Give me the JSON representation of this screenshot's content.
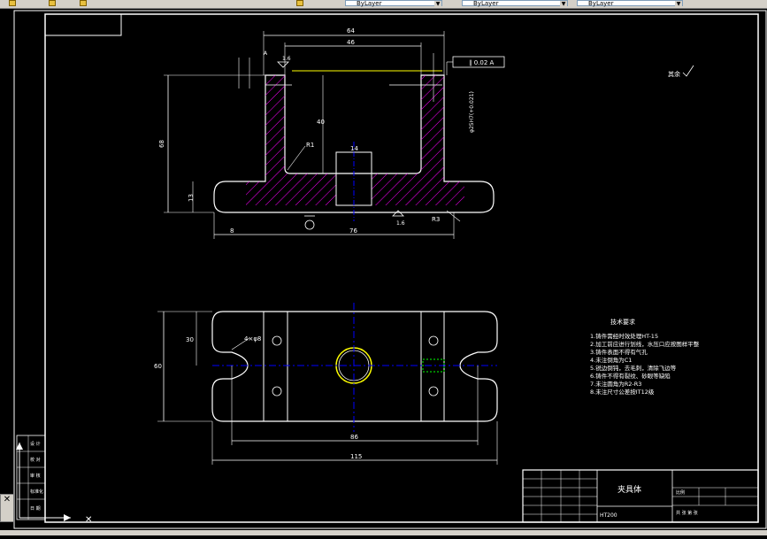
{
  "toolbar": {
    "combos": [
      "ByLayer",
      "ByLayer",
      "ByLayer"
    ],
    "colors": {
      "face": "#d4d0c8",
      "combo_bg": "#ffffff"
    }
  },
  "drawing": {
    "colors": {
      "background": "#000000",
      "lines": "#ffffff",
      "hatch": "#ff00ff",
      "centerline": "#0000ff",
      "yellow": "#ffff00",
      "green": "#00ff00"
    },
    "front_view": {
      "dim_top_outer": "64",
      "dim_top_inner": "46",
      "dim_left_height": "68",
      "dim_inner_height": "40",
      "dim_base_height": "13",
      "dim_bottom": "76",
      "dim_bottom_left": "8",
      "dim_slot": "14",
      "radius_label": "R1",
      "radius_label_2": "R3",
      "roughness_top": "1.6",
      "roughness_bottom": "1.6",
      "datum_flag": "∥ 0.02 A",
      "datum_letter": "A",
      "side_note": "φ25H7(+0.021)"
    },
    "top_view": {
      "dim_width": "60",
      "dim_inner": "30",
      "dim_span_inner": "86",
      "dim_span_outer": "115",
      "hole_label": "4×φ8"
    },
    "roughness_corner": "其余",
    "tech_req_title": "技术要求",
    "tech_reqs": [
      "1.铸件需经时效处理HT-15",
      "2.加工前应进行划线，水压口应按图样平整",
      "3.铸件表面不得有气孔",
      "4.未注倒角为C1",
      "5.锐边倒钝，去毛刺，清除飞边等",
      "6.铸件不得有裂纹、砂眼等缺陷",
      "7.未注圆角为R2-R3",
      "8.未注尺寸公差按IT12级"
    ],
    "title_block": {
      "part_name": "夹具体",
      "scale_label": "比例",
      "material": "HT200",
      "sheet_label": "共 张 第 张"
    },
    "side_table": {
      "row1": "设 计",
      "row2": "校 对",
      "row3": "审 核",
      "row4": "标准化",
      "row5": "日 期"
    }
  }
}
